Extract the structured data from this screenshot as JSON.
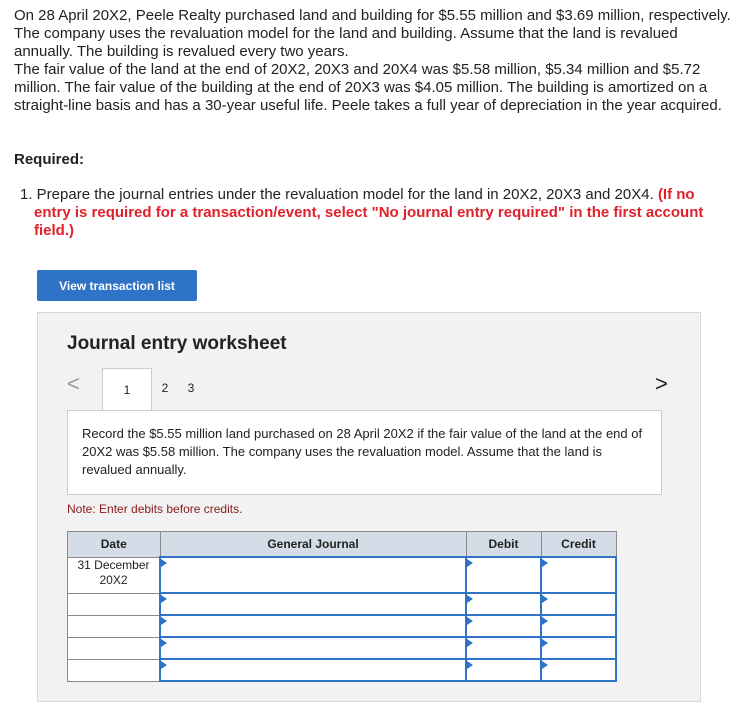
{
  "problem": {
    "p1": "On 28 April 20X2, Peele Realty purchased land and building for $5.55 million and $3.69 million, respectively. The company uses the revaluation model for the land and building. Assume that the land is revalued annually. The building is revalued every two years.",
    "p2": "The fair value of the land at the end of 20X2, 20X3 and 20X4 was $5.58 million, $5.34 million and $5.72 million. The fair value of the building at the end of 20X3 was $4.05 million. The building is amortized on a straight-line basis and has a 30-year useful life. Peele takes a full year of depreciation in the year acquired."
  },
  "required_label": "Required:",
  "item": {
    "text": "1. Prepare the journal entries under the revaluation model for the land in 20X2, 20X3 and 20X4.",
    "red_first": "(If no",
    "red_rest": "entry is required for a transaction/event, select \"No journal entry required\" in the first account field.)"
  },
  "view_button": "View transaction list",
  "worksheet": {
    "title": "Journal entry worksheet",
    "prev": "<",
    "next": ">",
    "tabs": [
      "1",
      "2",
      "3"
    ],
    "instruction": "Record the $5.55 million land purchased on 28 April 20X2 if the fair value of the land at the end of 20X2 was $5.58 million. The company uses the revaluation model. Assume that the land is revalued annually.",
    "note": "Note: Enter debits before credits.",
    "columns": [
      "Date",
      "General Journal",
      "Debit",
      "Credit"
    ],
    "first_date": "31 December 20X2"
  }
}
